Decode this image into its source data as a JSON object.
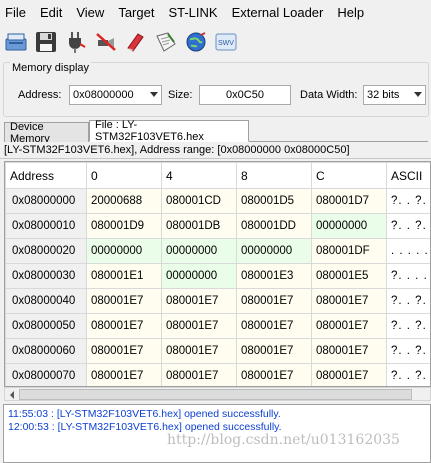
{
  "menu": [
    "File",
    "Edit",
    "View",
    "Target",
    "ST-LINK",
    "External Loader",
    "Help"
  ],
  "toolbar_icons": [
    "connect-icon",
    "save-icon",
    "plug-icon",
    "disconnect-icon",
    "erase-icon",
    "program-icon",
    "globe-icon",
    "swv-icon"
  ],
  "swv_label": "SWV",
  "memory_display": {
    "legend": "Memory display",
    "address_label": "Address:",
    "address_value": "0x08000000",
    "size_label": "Size:",
    "size_value": "0x0C50",
    "data_width_label": "Data Width:",
    "data_width_value": "32 bits"
  },
  "tabs": [
    {
      "label": "Device Memory",
      "active": false
    },
    {
      "label": "File : LY-STM32F103VET6.hex",
      "active": true
    }
  ],
  "status_line": "[LY-STM32F103VET6.hex], Address range: [0x08000000 0x08000C50]",
  "grid": {
    "headers": [
      "Address",
      "0",
      "4",
      "8",
      "C",
      "ASCII"
    ],
    "rows": [
      {
        "addr": "0x08000000",
        "cells": [
          "20000688",
          "080001CD",
          "080001D5",
          "080001D7"
        ],
        "ascii": "?. . ?. . ."
      },
      {
        "addr": "0x08000010",
        "cells": [
          "080001D9",
          "080001DB",
          "080001DD",
          "00000000"
        ],
        "ascii": "?. . ?. . ."
      },
      {
        "addr": "0x08000020",
        "cells": [
          "00000000",
          "00000000",
          "00000000",
          "080001DF"
        ],
        "ascii": ". . . . . . ."
      },
      {
        "addr": "0x08000030",
        "cells": [
          "080001E1",
          "00000000",
          "080001E3",
          "080001E5"
        ],
        "ascii": "?. . . . . ."
      },
      {
        "addr": "0x08000040",
        "cells": [
          "080001E7",
          "080001E7",
          "080001E7",
          "080001E7"
        ],
        "ascii": "?. . ?. . ."
      },
      {
        "addr": "0x08000050",
        "cells": [
          "080001E7",
          "080001E7",
          "080001E7",
          "080001E7"
        ],
        "ascii": "?. . ?. . ."
      },
      {
        "addr": "0x08000060",
        "cells": [
          "080001E7",
          "080001E7",
          "080001E7",
          "080001E7"
        ],
        "ascii": "?. . ?. . ."
      },
      {
        "addr": "0x08000070",
        "cells": [
          "080001E7",
          "080001E7",
          "080001E7",
          "080001E7"
        ],
        "ascii": "?. . ?. . ."
      }
    ]
  },
  "log": [
    "11:55:03 : [LY-STM32F103VET6.hex] opened successfully.",
    "12:00:53 : [LY-STM32F103VET6.hex] opened successfully."
  ],
  "watermark": "http://blog.csdn.net/u013162035"
}
